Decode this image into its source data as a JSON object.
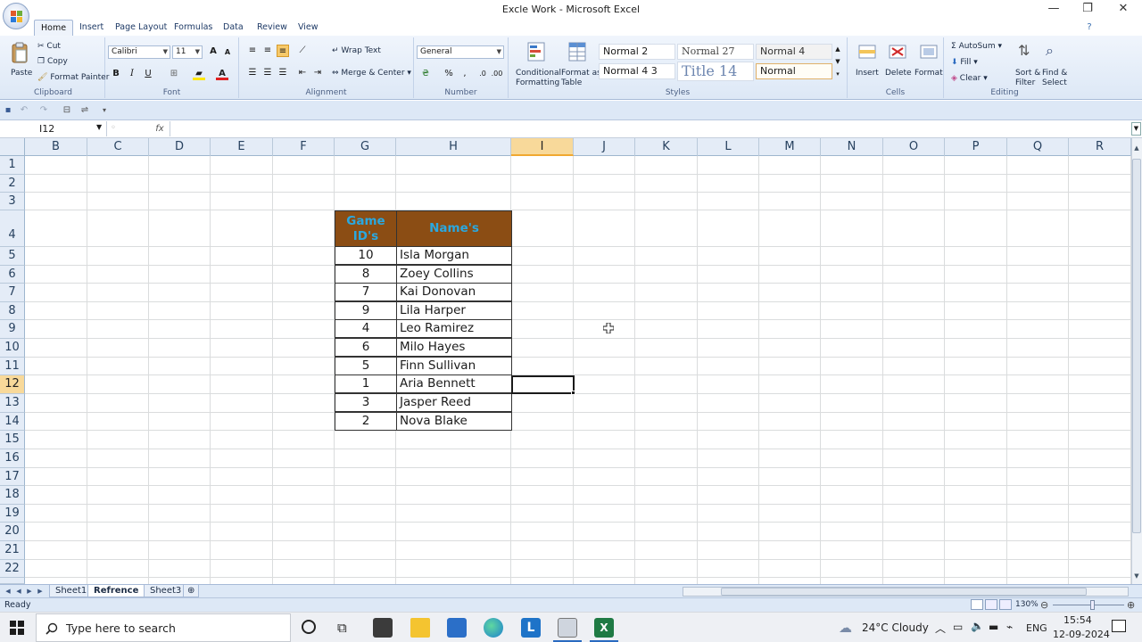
{
  "window": {
    "title": "Excle Work - Microsoft Excel",
    "minimize": "—",
    "restore": "❐",
    "close": "✕"
  },
  "ribbon_tabs": [
    "Home",
    "Insert",
    "Page Layout",
    "Formulas",
    "Data",
    "Review",
    "View"
  ],
  "ribbon": {
    "clipboard": {
      "paste": "Paste",
      "cut": "Cut",
      "copy": "Copy",
      "format_painter": "Format Painter",
      "label": "Clipboard"
    },
    "font": {
      "name": "Calibri",
      "size": "11",
      "bold": "B",
      "italic": "I",
      "underline": "U",
      "label": "Font"
    },
    "alignment": {
      "wrap_text": "Wrap Text",
      "merge_center": "Merge & Center",
      "label": "Alignment"
    },
    "number": {
      "format": "General",
      "percent": "%",
      "comma": ",",
      "label": "Number"
    },
    "styles": {
      "conditional": [
        "Conditional",
        "Formatting"
      ],
      "format_table": [
        "Format as",
        "Table"
      ],
      "cell_styles": [
        "Normal 2",
        "Normal 27",
        "Normal 4",
        "Normal 4 3",
        "Title 14",
        "Normal"
      ],
      "label": "Styles"
    },
    "cells": {
      "insert": "Insert",
      "delete": "Delete",
      "format": "Format",
      "label": "Cells"
    },
    "editing": {
      "autosum": "AutoSum",
      "fill": "Fill",
      "clear": "Clear",
      "sort": [
        "Sort &",
        "Filter"
      ],
      "find": [
        "Find &",
        "Select"
      ],
      "label": "Editing"
    }
  },
  "formula_bar": {
    "name_box": "I12",
    "fx": "fx",
    "formula": ""
  },
  "columns": [
    "B",
    "C",
    "D",
    "E",
    "F",
    "G",
    "H",
    "I",
    "J",
    "K",
    "L",
    "M",
    "N",
    "O",
    "P",
    "Q",
    "R"
  ],
  "selected_column": "I",
  "rows": [
    "1",
    "2",
    "3",
    "4",
    "5",
    "6",
    "7",
    "8",
    "9",
    "10",
    "11",
    "12",
    "13",
    "14",
    "15",
    "16",
    "17",
    "18",
    "19",
    "20",
    "21",
    "22"
  ],
  "selected_row": "12",
  "table": {
    "headers": {
      "id_line1": "Game",
      "id_line2": "ID's",
      "name": "Name's"
    },
    "header_bg": "#8b4d14",
    "header_fg": "#2aa8e0",
    "rows": [
      {
        "id": "10",
        "name": "Isla Morgan"
      },
      {
        "id": "8",
        "name": "Zoey Collins"
      },
      {
        "id": "7",
        "name": "Kai Donovan"
      },
      {
        "id": "9",
        "name": "Lila Harper"
      },
      {
        "id": "4",
        "name": "Leo Ramirez"
      },
      {
        "id": "6",
        "name": "Milo Hayes"
      },
      {
        "id": "5",
        "name": "Finn Sullivan"
      },
      {
        "id": "1",
        "name": "Aria Bennett"
      },
      {
        "id": "3",
        "name": "Jasper Reed"
      },
      {
        "id": "2",
        "name": "Nova Blake"
      }
    ]
  },
  "sheets": [
    "Sheet1",
    "Refrence",
    "Sheet3"
  ],
  "active_sheet": "Refrence",
  "status": {
    "ready": "Ready",
    "zoom": "130%"
  },
  "taskbar": {
    "search_placeholder": "Type here to search",
    "weather": "24°C  Cloudy",
    "language": "ENG",
    "time": "15:54",
    "date": "12-09-2024"
  }
}
